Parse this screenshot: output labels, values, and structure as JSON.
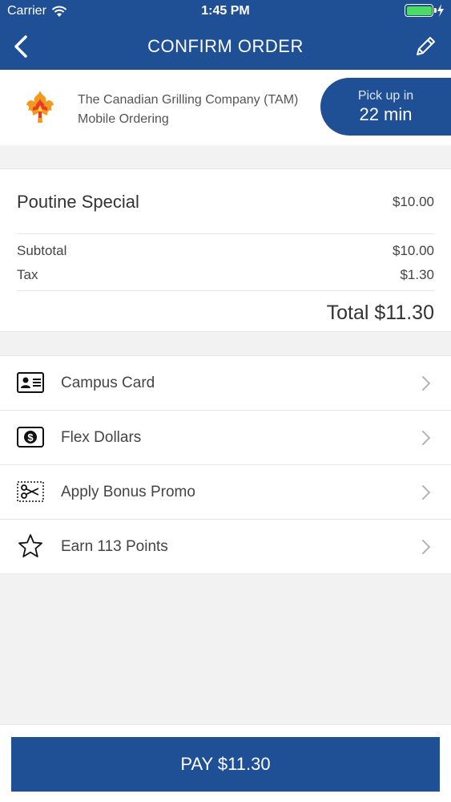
{
  "status_bar": {
    "carrier": "Carrier",
    "time": "1:45 PM",
    "battery_color": "#4cd964"
  },
  "nav": {
    "title": "CONFIRM ORDER",
    "back_icon": "chevron-left-icon",
    "edit_icon": "pencil-icon"
  },
  "restaurant": {
    "name": "The Canadian Grilling Company (TAM)",
    "subtitle": "Mobile Ordering",
    "logo_icon": "flame-maple-leaf-logo",
    "pickup_label": "Pick up in",
    "pickup_time": "22 min"
  },
  "order": {
    "items": [
      {
        "name": "Poutine Special",
        "price": "$10.00"
      }
    ],
    "subtotal_label": "Subtotal",
    "subtotal_value": "$10.00",
    "tax_label": "Tax",
    "tax_value": "$1.30",
    "total": "Total $11.30"
  },
  "payment_options": [
    {
      "label": "Campus Card",
      "icon": "id-card-icon"
    },
    {
      "label": "Flex Dollars",
      "icon": "dollar-bill-icon"
    },
    {
      "label": "Apply Bonus Promo",
      "icon": "coupon-scissors-icon"
    },
    {
      "label": "Earn 113 Points",
      "icon": "star-icon"
    }
  ],
  "pay_button": "PAY $11.30",
  "colors": {
    "brand_blue": "#1f4f95",
    "background": "#f2f2f2"
  }
}
